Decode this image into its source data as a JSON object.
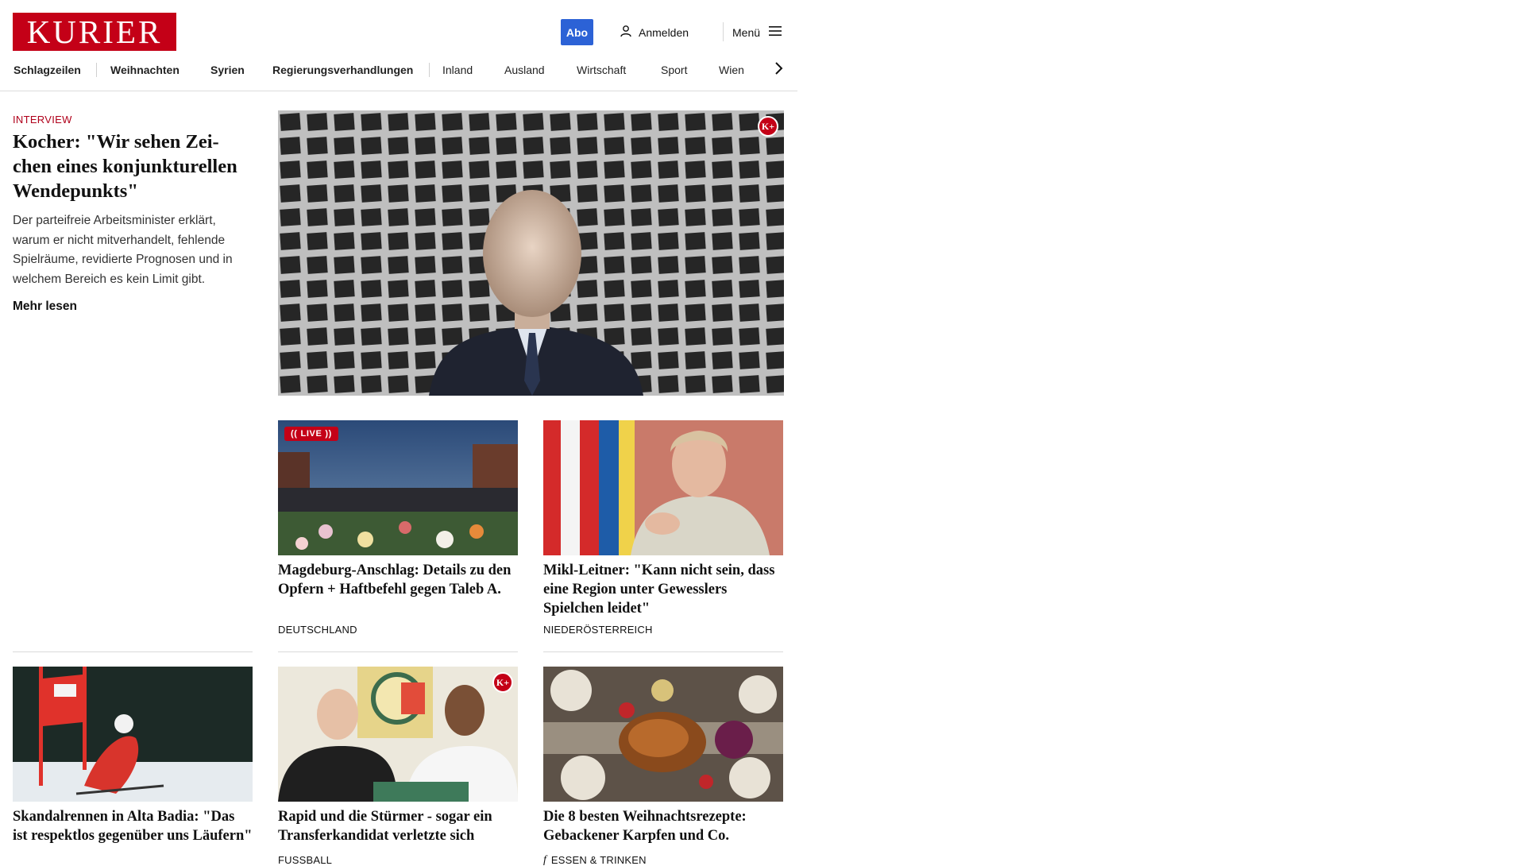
{
  "header": {
    "logo": "KURIER",
    "abo_label": "Abo",
    "login_label": "Anmelden",
    "menu_label": "Menü"
  },
  "nav": {
    "items": [
      {
        "label": "Schlagzeilen"
      },
      {
        "label": "Weihnachten"
      },
      {
        "label": "Syrien"
      },
      {
        "label": "Regierungsverhandlungen"
      },
      {
        "label": "Inland"
      },
      {
        "label": "Ausland"
      },
      {
        "label": "Wirtschaft"
      },
      {
        "label": "Sport"
      },
      {
        "label": "Wien"
      }
    ]
  },
  "lead": {
    "kicker": "INTERVIEW",
    "title": "Kocher: \"Wir sehen Zei­chen eines konjunkturel­len Wendepunkts\"",
    "teaser": "Der parteifreie Arbeitsminister erklärt, warum er nicht mitverhandelt, fehlende Spielräume, revidierte Prognosen und in welchem Bereich es kein Limit gibt.",
    "more_label": "Mehr lesen",
    "badge": "K+"
  },
  "cards": [
    {
      "title": "Magdeburg-Anschlag: Details zu den Opfern + Haftbefehl gegen Ta­leb A.",
      "category": "DEUTSCHLAND",
      "live_label": "LIVE"
    },
    {
      "title": "Mikl-Leitner: \"Kann nicht sein, dass eine Region unter Gewesslers Spielchen leidet\"",
      "category": "NIEDERÖSTERREICH"
    },
    {
      "title": "Skandalrennen in Alta Badia: \"Das ist respektlos gegenüber uns Läufern\"",
      "category": ""
    },
    {
      "title": "Rapid und die Stürmer - sogar ein Transferkandidat verletzte sich",
      "category": "FUSSBALL",
      "badge": "K+"
    },
    {
      "title": "Die 8 besten Weihnachtsrezepte: Gebackener Karpfen und Co.",
      "category": "ESSEN & TRINKEN"
    }
  ]
}
